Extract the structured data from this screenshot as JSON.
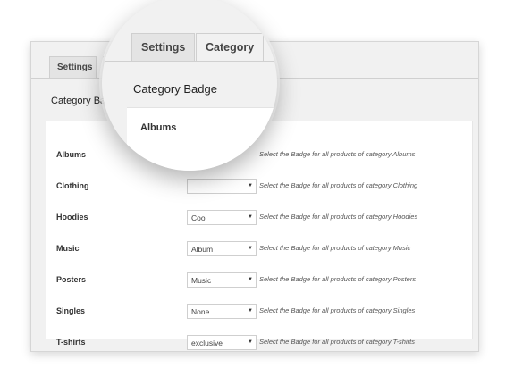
{
  "tabs": [
    {
      "label": "Settings"
    },
    {
      "label": "C"
    }
  ],
  "section_title": "Category Bad",
  "rows": [
    {
      "label": "Albums",
      "select": "",
      "description": "Select the Badge for all products of category Albums"
    },
    {
      "label": "Clothing",
      "select": "",
      "description": "Select the Badge for all products of category Clothing"
    },
    {
      "label": "Hoodies",
      "select": "Cool",
      "description": "Select the Badge for all products of category Hoodies"
    },
    {
      "label": "Music",
      "select": "Album",
      "description": "Select the Badge for all products of category Music"
    },
    {
      "label": "Posters",
      "select": "Music",
      "description": "Select the Badge for all products of category Posters"
    },
    {
      "label": "Singles",
      "select": "None",
      "description": "Select the Badge for all products of category Singles"
    },
    {
      "label": "T-shirts",
      "select": "exclusive",
      "description": "Select the Badge for all products of category T-shirts"
    }
  ],
  "dropdown_arrow": "▼",
  "magnifier": {
    "tab_settings": "Settings",
    "tab_category": "Category",
    "title": "Category Badge",
    "first_row_label": "Albums"
  }
}
